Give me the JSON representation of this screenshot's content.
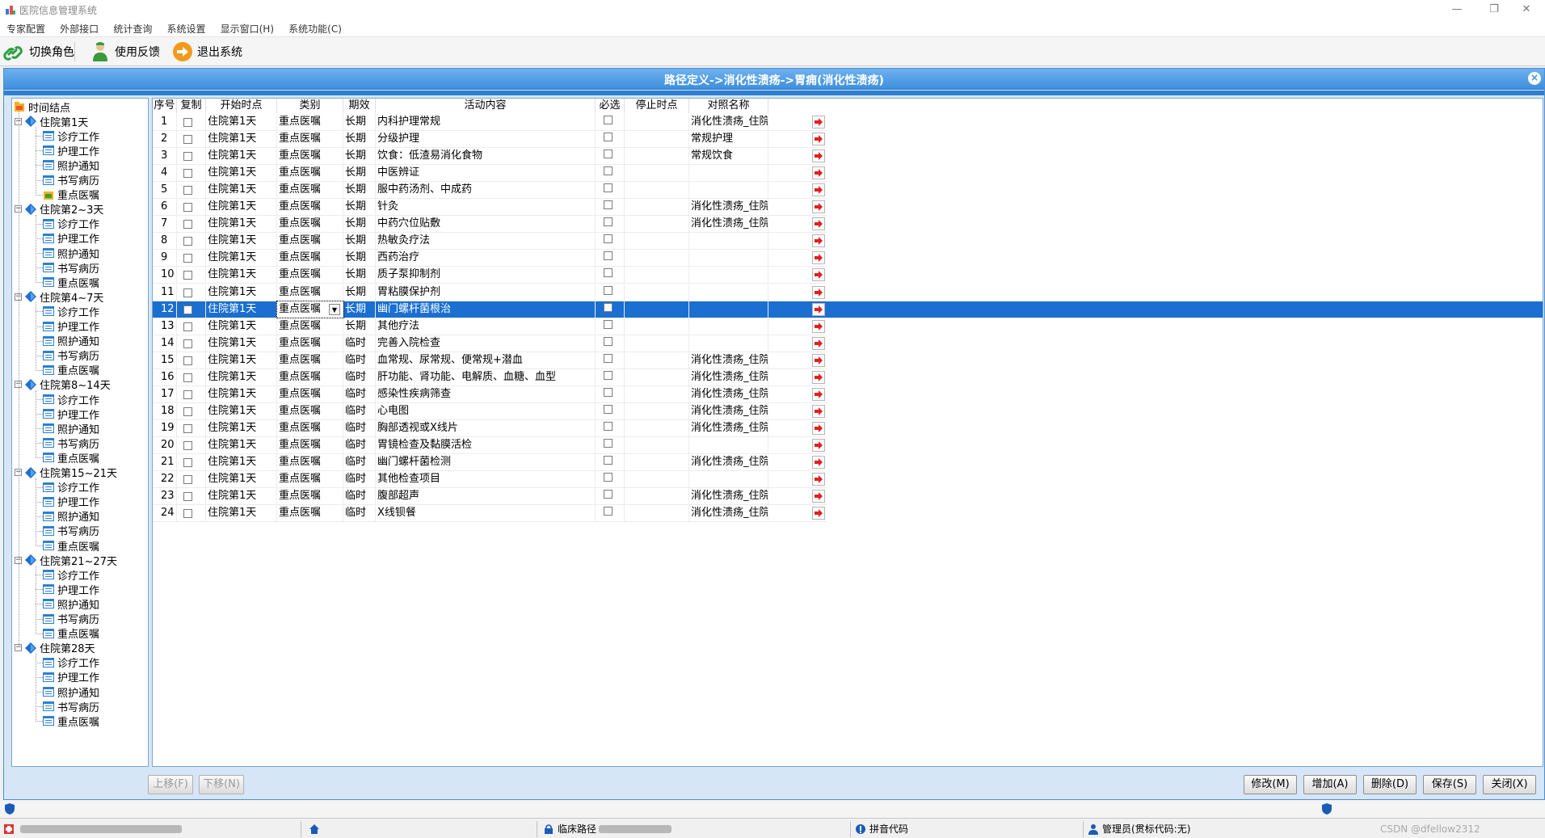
{
  "window": {
    "title": "医院信息管理系统",
    "minimize": "—",
    "restore": "❐",
    "close": "✕"
  },
  "menu": [
    "专家配置",
    "外部接口",
    "统计查询",
    "系统设置",
    "显示窗口(H)",
    "系统功能(C)"
  ],
  "toolbar": {
    "switch_role": "切换角色",
    "feedback": "使用反馈",
    "exit": "退出系统"
  },
  "header": {
    "breadcrumb": "路径定义->消化性溃疡->胃痈(消化性溃疡)",
    "close": "×"
  },
  "tree": {
    "root": "时间结点",
    "groups": [
      {
        "label": "住院第1天",
        "children": [
          "诊疗工作",
          "护理工作",
          "照护通知",
          "书写病历",
          "重点医嘱"
        ]
      },
      {
        "label": "住院第2~3天",
        "children": [
          "诊疗工作",
          "护理工作",
          "照护通知",
          "书写病历",
          "重点医嘱"
        ]
      },
      {
        "label": "住院第4~7天",
        "children": [
          "诊疗工作",
          "护理工作",
          "照护通知",
          "书写病历",
          "重点医嘱"
        ]
      },
      {
        "label": "住院第8~14天",
        "children": [
          "诊疗工作",
          "护理工作",
          "照护通知",
          "书写病历",
          "重点医嘱"
        ]
      },
      {
        "label": "住院第15~21天",
        "children": [
          "诊疗工作",
          "护理工作",
          "照护通知",
          "书写病历",
          "重点医嘱"
        ]
      },
      {
        "label": "住院第21~27天",
        "children": [
          "诊疗工作",
          "护理工作",
          "照护通知",
          "书写病历",
          "重点医嘱"
        ]
      },
      {
        "label": "住院第28天",
        "children": [
          "诊疗工作",
          "护理工作",
          "照护通知",
          "书写病历",
          "重点医嘱"
        ]
      }
    ]
  },
  "grid": {
    "columns": [
      "序号",
      "复制",
      "开始时点",
      "类别",
      "期效",
      "活动内容",
      "必选",
      "停止时点",
      "对照名称"
    ],
    "selected_row": 12,
    "rows": [
      {
        "no": "1",
        "start": "住院第1天",
        "category": "重点医嘱",
        "term": "长期",
        "content": "内科护理常规",
        "stop": "",
        "mapping": "消化性溃疡_住院第"
      },
      {
        "no": "2",
        "start": "住院第1天",
        "category": "重点医嘱",
        "term": "长期",
        "content": "分级护理",
        "stop": "",
        "mapping": "常规护理"
      },
      {
        "no": "3",
        "start": "住院第1天",
        "category": "重点医嘱",
        "term": "长期",
        "content": "饮食：低渣易消化食物",
        "stop": "",
        "mapping": "常规饮食"
      },
      {
        "no": "4",
        "start": "住院第1天",
        "category": "重点医嘱",
        "term": "长期",
        "content": "中医辨证",
        "stop": "",
        "mapping": ""
      },
      {
        "no": "5",
        "start": "住院第1天",
        "category": "重点医嘱",
        "term": "长期",
        "content": "服中药汤剂、中成药",
        "stop": "",
        "mapping": ""
      },
      {
        "no": "6",
        "start": "住院第1天",
        "category": "重点医嘱",
        "term": "长期",
        "content": "针灸",
        "stop": "",
        "mapping": "消化性溃疡_住院第"
      },
      {
        "no": "7",
        "start": "住院第1天",
        "category": "重点医嘱",
        "term": "长期",
        "content": "中药穴位贴敷",
        "stop": "",
        "mapping": "消化性溃疡_住院第"
      },
      {
        "no": "8",
        "start": "住院第1天",
        "category": "重点医嘱",
        "term": "长期",
        "content": "热敏灸疗法",
        "stop": "",
        "mapping": ""
      },
      {
        "no": "9",
        "start": "住院第1天",
        "category": "重点医嘱",
        "term": "长期",
        "content": "西药治疗",
        "stop": "",
        "mapping": ""
      },
      {
        "no": "10",
        "start": "住院第1天",
        "category": "重点医嘱",
        "term": "长期",
        "content": "质子泵抑制剂",
        "stop": "",
        "mapping": ""
      },
      {
        "no": "11",
        "start": "住院第1天",
        "category": "重点医嘱",
        "term": "长期",
        "content": "胃粘膜保护剂",
        "stop": "",
        "mapping": ""
      },
      {
        "no": "12",
        "start": "住院第1天",
        "category": "重点医嘱",
        "term": "长期",
        "content": "幽门螺杆菌根治",
        "stop": "",
        "mapping": ""
      },
      {
        "no": "13",
        "start": "住院第1天",
        "category": "重点医嘱",
        "term": "长期",
        "content": "其他疗法",
        "stop": "",
        "mapping": ""
      },
      {
        "no": "14",
        "start": "住院第1天",
        "category": "重点医嘱",
        "term": "临时",
        "content": "完善入院检查",
        "stop": "",
        "mapping": ""
      },
      {
        "no": "15",
        "start": "住院第1天",
        "category": "重点医嘱",
        "term": "临时",
        "content": "血常规、尿常规、便常规+潜血",
        "stop": "",
        "mapping": "消化性溃疡_住院第"
      },
      {
        "no": "16",
        "start": "住院第1天",
        "category": "重点医嘱",
        "term": "临时",
        "content": "肝功能、肾功能、电解质、血糖、血型",
        "stop": "",
        "mapping": "消化性溃疡_住院第"
      },
      {
        "no": "17",
        "start": "住院第1天",
        "category": "重点医嘱",
        "term": "临时",
        "content": "感染性疾病筛查",
        "stop": "",
        "mapping": "消化性溃疡_住院第"
      },
      {
        "no": "18",
        "start": "住院第1天",
        "category": "重点医嘱",
        "term": "临时",
        "content": "心电图",
        "stop": "",
        "mapping": "消化性溃疡_住院第"
      },
      {
        "no": "19",
        "start": "住院第1天",
        "category": "重点医嘱",
        "term": "临时",
        "content": "胸部透视或X线片",
        "stop": "",
        "mapping": "消化性溃疡_住院第"
      },
      {
        "no": "20",
        "start": "住院第1天",
        "category": "重点医嘱",
        "term": "临时",
        "content": "胃镜检查及黏膜活检",
        "stop": "",
        "mapping": ""
      },
      {
        "no": "21",
        "start": "住院第1天",
        "category": "重点医嘱",
        "term": "临时",
        "content": "幽门螺杆菌检测",
        "stop": "",
        "mapping": "消化性溃疡_住院第"
      },
      {
        "no": "22",
        "start": "住院第1天",
        "category": "重点医嘱",
        "term": "临时",
        "content": "其他检查项目",
        "stop": "",
        "mapping": ""
      },
      {
        "no": "23",
        "start": "住院第1天",
        "category": "重点医嘱",
        "term": "临时",
        "content": "腹部超声",
        "stop": "",
        "mapping": "消化性溃疡_住院第"
      },
      {
        "no": "24",
        "start": "住院第1天",
        "category": "重点医嘱",
        "term": "临时",
        "content": "X线钡餐",
        "stop": "",
        "mapping": "消化性溃疡_住院第"
      }
    ]
  },
  "buttons": {
    "move_up": "上移(F)",
    "move_down": "下移(N)",
    "modify": "修改(M)",
    "add": "增加(A)",
    "delete": "删除(D)",
    "save": "保存(S)",
    "close": "关闭(X)"
  },
  "status": {
    "clinical_path": "临床路径",
    "pinyin": "拼音代码",
    "user": "管理员(贯标代码:无)",
    "watermark": "CSDN @dfellow2312"
  },
  "colors": {
    "accent": "#3d8fdc",
    "selection": "#1a6fd1",
    "arrow_red": "#e02020"
  }
}
